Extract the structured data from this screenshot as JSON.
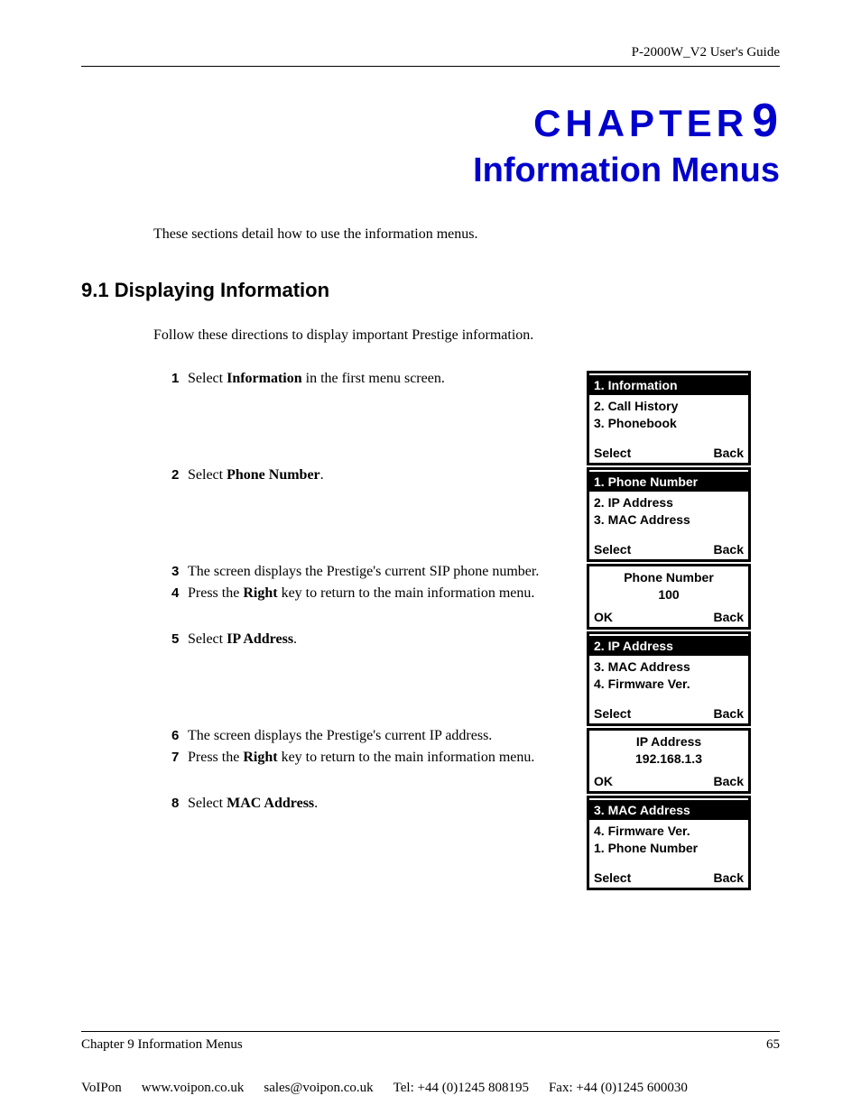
{
  "header": {
    "guide": "P-2000W_V2 User's Guide"
  },
  "chapter": {
    "label": "CHAPTER",
    "number": "9",
    "title": "Information Menus",
    "intro": "These sections detail how to use the information menus."
  },
  "section": {
    "heading": "9.1  Displaying Information",
    "intro": "Follow these directions to display important Prestige information."
  },
  "steps": {
    "s1": {
      "num": "1",
      "pre": "Select ",
      "bold": "Information",
      "post": " in the first menu screen."
    },
    "s2": {
      "num": "2",
      "pre": "Select ",
      "bold": "Phone Number",
      "post": "."
    },
    "s3": {
      "num": "3",
      "text": "The screen displays the Prestige's current SIP phone number."
    },
    "s4": {
      "num": "4",
      "pre": "Press the ",
      "bold": "Right",
      "post": " key to return to the main information menu."
    },
    "s5": {
      "num": "5",
      "pre": "Select ",
      "bold": "IP Address",
      "post": "."
    },
    "s6": {
      "num": "6",
      "text": "The screen displays the Prestige's current IP address."
    },
    "s7": {
      "num": "7",
      "pre": "Press the ",
      "bold": "Right",
      "post": " key to return to the main information menu."
    },
    "s8": {
      "num": "8",
      "pre": "Select ",
      "bold": "MAC Address",
      "post": "."
    }
  },
  "screens": {
    "a": {
      "head": "1. Information",
      "l1": "2. Call History",
      "l2": "3. Phonebook",
      "left": "Select",
      "right": "Back"
    },
    "b": {
      "head": "1. Phone Number",
      "l1": "2. IP Address",
      "l2": "3. MAC Address",
      "left": "Select",
      "right": "Back"
    },
    "c": {
      "l1": "Phone Number",
      "l2": "100",
      "left": "OK",
      "right": "Back"
    },
    "d": {
      "head": "2. IP Address",
      "l1": "3. MAC Address",
      "l2": "4. Firmware Ver.",
      "left": "Select",
      "right": "Back"
    },
    "e": {
      "l1": "IP Address",
      "l2": "192.168.1.3",
      "left": "OK",
      "right": "Back"
    },
    "f": {
      "head": "3. MAC Address",
      "l1": "4. Firmware Ver.",
      "l2": "1. Phone Number",
      "left": "Select",
      "right": "Back"
    }
  },
  "footer": {
    "chapter": "Chapter 9 Information Menus",
    "page": "65"
  },
  "colophon": {
    "brand": "VoIPon",
    "web": "www.voipon.co.uk",
    "email": "sales@voipon.co.uk",
    "tel": "Tel: +44 (0)1245 808195",
    "fax": "Fax: +44 (0)1245 600030"
  }
}
